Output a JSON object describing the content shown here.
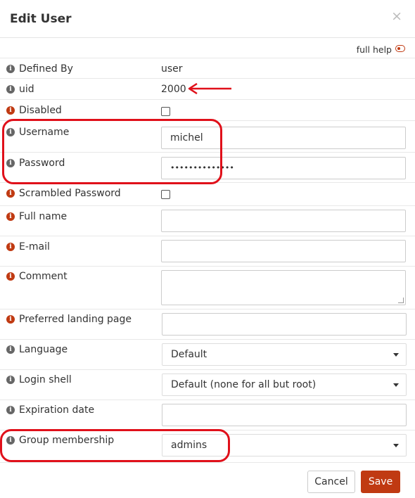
{
  "dialog": {
    "title": "Edit User",
    "close_icon": "×"
  },
  "help": {
    "label": "full help"
  },
  "fields": {
    "defined_by": {
      "label": "Defined By",
      "value": "user"
    },
    "uid": {
      "label": "uid",
      "value": "2000"
    },
    "disabled": {
      "label": "Disabled",
      "checked": false
    },
    "username": {
      "label": "Username",
      "value": "michel"
    },
    "password": {
      "label": "Password",
      "value": "••••••••••••••"
    },
    "scrambled_password": {
      "label": "Scrambled Password",
      "checked": false
    },
    "full_name": {
      "label": "Full name",
      "value": ""
    },
    "email": {
      "label": "E-mail",
      "value": ""
    },
    "comment": {
      "label": "Comment",
      "value": ""
    },
    "landing_page": {
      "label": "Preferred landing page",
      "value": ""
    },
    "language": {
      "label": "Language",
      "value": "Default"
    },
    "login_shell": {
      "label": "Login shell",
      "value": "Default (none for all but root)"
    },
    "expiration_date": {
      "label": "Expiration date",
      "value": ""
    },
    "group_membership": {
      "label": "Group membership",
      "value": "admins"
    }
  },
  "buttons": {
    "cancel": "Cancel",
    "save": "Save"
  },
  "colors": {
    "accent": "#c03a12",
    "annotation": "#e0101a",
    "info_grey": "#666666"
  },
  "icons": {
    "info": "i",
    "info_icon_name": "info-icon"
  }
}
